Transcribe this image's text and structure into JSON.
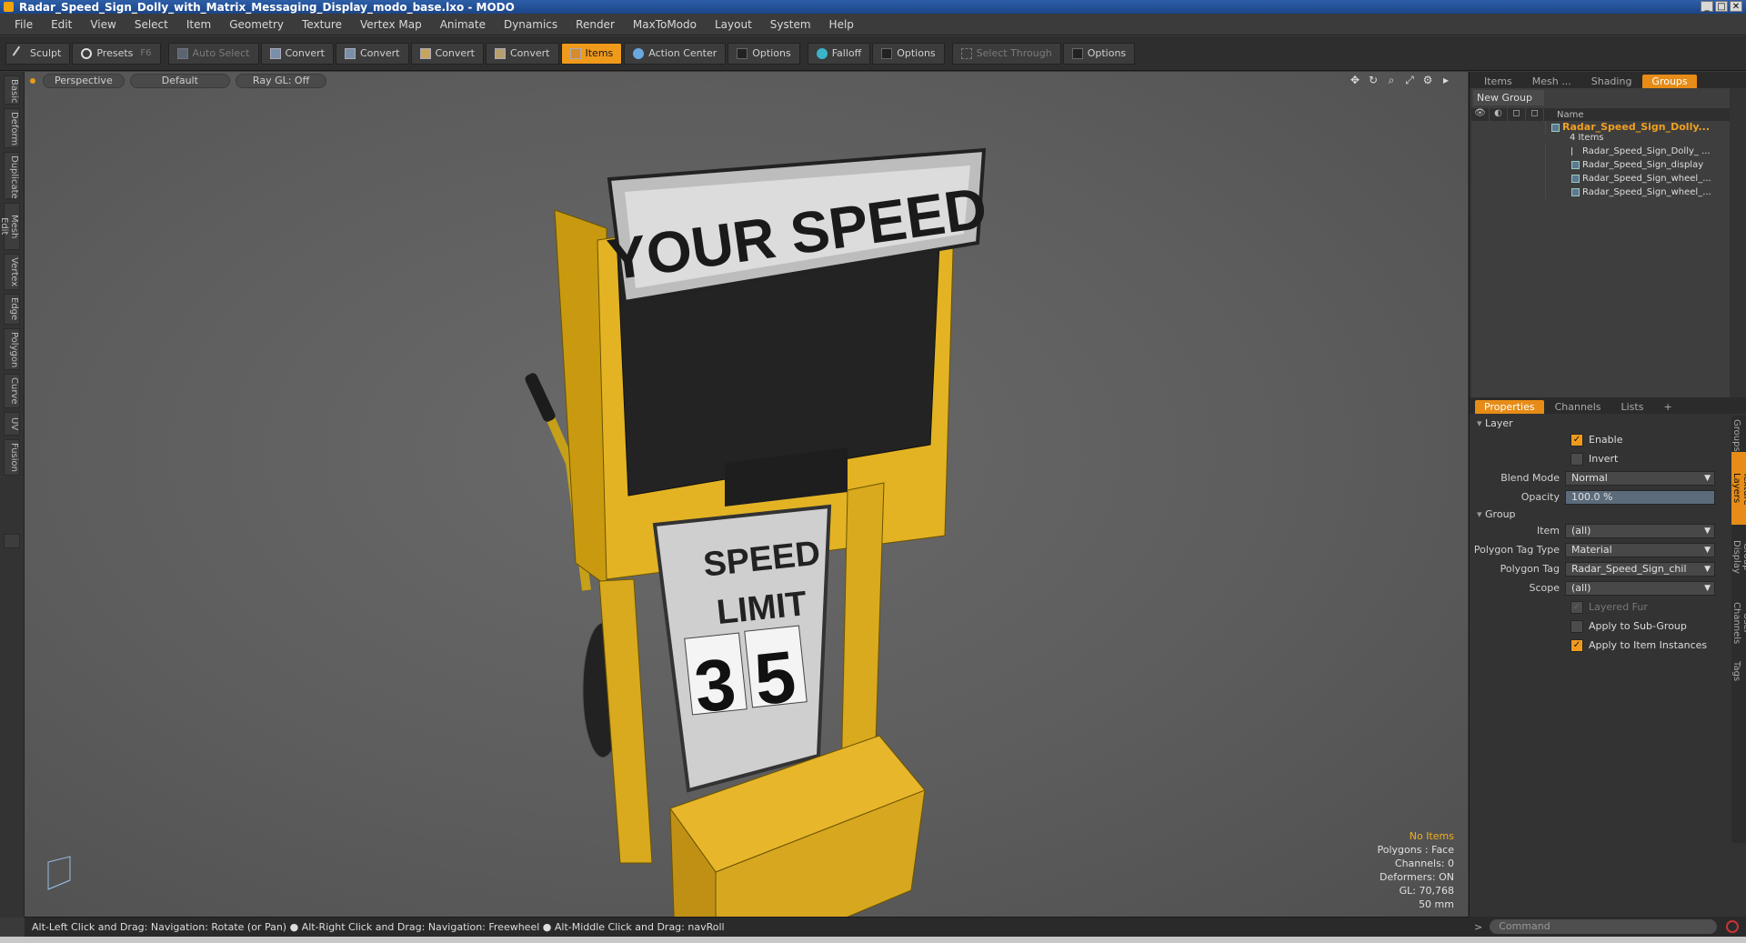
{
  "window": {
    "title": "Radar_Speed_Sign_Dolly_with_Matrix_Messaging_Display_modo_base.lxo - MODO"
  },
  "menu": [
    "File",
    "Edit",
    "View",
    "Select",
    "Item",
    "Geometry",
    "Texture",
    "Vertex Map",
    "Animate",
    "Dynamics",
    "Render",
    "MaxToModo",
    "Layout",
    "System",
    "Help"
  ],
  "toolbar": {
    "sculpt": "Sculpt",
    "presets": "Presets",
    "presets_key": "F6",
    "auto_select": "Auto Select",
    "convert": "Convert",
    "items": "Items",
    "action_center": "Action Center",
    "options": "Options",
    "falloff": "Falloff",
    "select_through": "Select Through"
  },
  "left_tabs": [
    "Basic",
    "Deform",
    "Duplicate",
    "Mesh Edit",
    "Vertex",
    "Edge",
    "Polygon",
    "Curve",
    "UV",
    "Fusion"
  ],
  "viewport": {
    "view": "Perspective",
    "shading": "Default",
    "raygl": "Ray GL: Off",
    "sign_top": "YOUR  SPEED",
    "sign_speed": "SPEED",
    "sign_limit": "LIMIT",
    "sign_digit1": "3",
    "sign_digit2": "5",
    "info": {
      "no_items": "No Items",
      "polygons": "Polygons : Face",
      "channels": "Channels: 0",
      "deformers": "Deformers: ON",
      "gl": "GL: 70,768",
      "size": "50 mm"
    }
  },
  "right_panel": {
    "top_tabs": [
      "Items",
      "Mesh ...",
      "Shading",
      "Groups"
    ],
    "new_group": "New Group",
    "name_col": "Name",
    "group_name": "Radar_Speed_Sign_Dolly...",
    "group_count": "4 Items",
    "children": [
      "Radar_Speed_Sign_Dolly_ ...",
      "Radar_Speed_Sign_display",
      "Radar_Speed_Sign_wheel_...",
      "Radar_Speed_Sign_wheel_..."
    ],
    "prop_tabs": [
      "Properties",
      "Channels",
      "Lists",
      "+"
    ],
    "layer_section": "Layer",
    "enable": "Enable",
    "invert": "Invert",
    "blend_mode_label": "Blend Mode",
    "blend_mode": "Normal",
    "opacity_label": "Opacity",
    "opacity": "100.0 %",
    "group_section": "Group",
    "item_label": "Item",
    "item_value": "(all)",
    "ptag_type_label": "Polygon Tag Type",
    "ptag_type": "Material",
    "ptag_label": "Polygon Tag",
    "ptag": "Radar_Speed_Sign_chil",
    "scope_label": "Scope",
    "scope": "(all)",
    "layered_fur": "Layered Fur",
    "apply_sub": "Apply to Sub-Group",
    "apply_inst": "Apply to Item Instances",
    "side_tabs": [
      "Groups",
      "Texture Layers",
      "Group Display",
      "User Channels",
      "Tags"
    ]
  },
  "status": "Alt-Left Click and Drag: Navigation: Rotate (or Pan) ● Alt-Right Click and Drag: Navigation: Freewheel ● Alt-Middle Click and Drag: navRoll",
  "command_placeholder": "Command"
}
